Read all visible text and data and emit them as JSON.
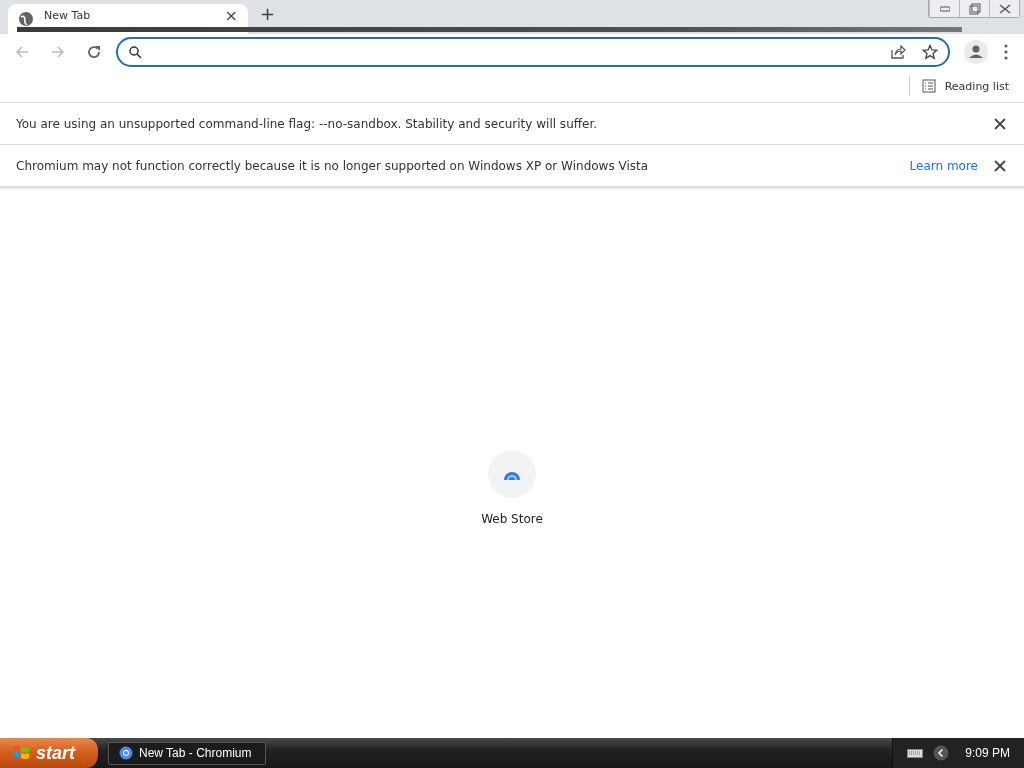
{
  "tab": {
    "title": "New Tab",
    "close": "×"
  },
  "new_tab": "+",
  "nav": {
    "back_disabled": true,
    "forward_disabled": true
  },
  "bookmarks_bar": {
    "reading_list": "Reading list"
  },
  "infobars": [
    {
      "message": "You are using an unsupported command-line flag: --no-sandbox. Stability and security will suffer."
    },
    {
      "message": "Chromium may not function correctly because it is no longer supported on Windows XP or Windows Vista",
      "link": "Learn more"
    }
  ],
  "shortcuts": [
    {
      "label": "Web Store"
    }
  ],
  "taskbar": {
    "start": "start",
    "tasks": [
      {
        "label": "New Tab - Chromium",
        "selected": false
      }
    ],
    "clock": "9:09 PM"
  }
}
